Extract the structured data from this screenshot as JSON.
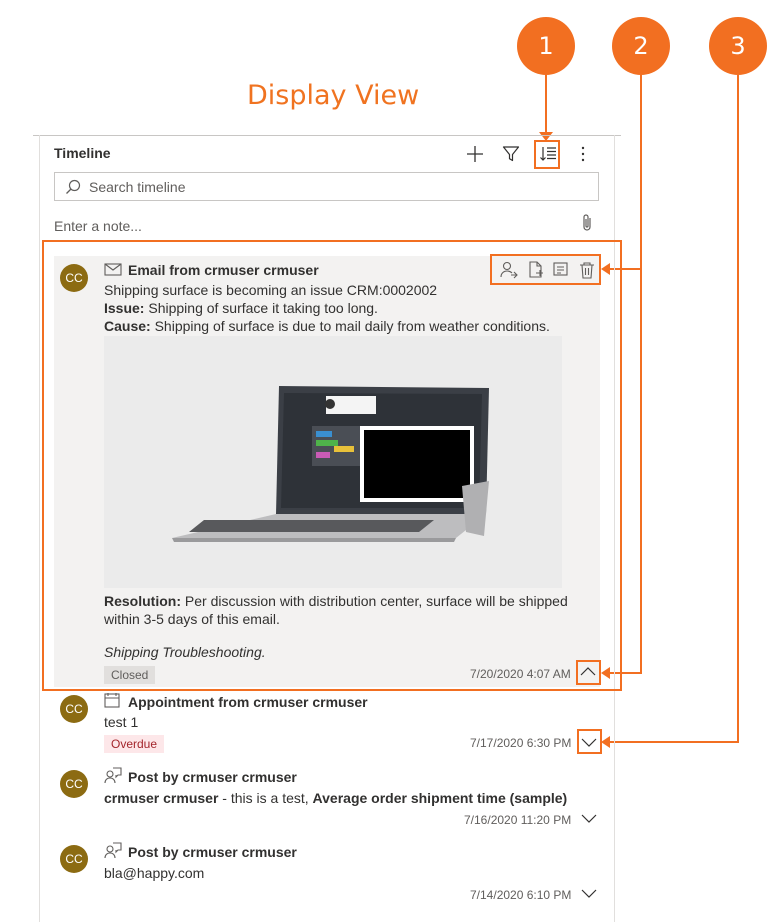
{
  "page_title": "Display View",
  "callouts": [
    "1",
    "2",
    "3"
  ],
  "timeline": {
    "title": "Timeline",
    "search_placeholder": "Search timeline",
    "note_placeholder": "Enter a note..."
  },
  "records": [
    {
      "type": "email",
      "header": "Email from crmuser crmuser",
      "subject": "Shipping surface is becoming an issue CRM:0002002",
      "issue_label": "Issue:",
      "issue_text": "Shipping of surface it taking too long.",
      "cause_label": "Cause:",
      "cause_text": "Shipping of surface is due to mail daily from weather conditions.",
      "resolution_label": "Resolution:",
      "resolution_text_1": "Per discussion with distribution center, surface will be shipped",
      "resolution_text_2": "within 3-5 days of this email.",
      "signature": "Shipping Troubleshooting.",
      "status": "Closed",
      "timestamp": "7/20/2020 4:07 AM",
      "avatar": "CC"
    },
    {
      "type": "appointment",
      "header": "Appointment from crmuser crmuser",
      "body": "test 1",
      "status": "Overdue",
      "timestamp": "7/17/2020 6:30 PM",
      "avatar": "CC"
    },
    {
      "type": "post",
      "header": "Post by crmuser crmuser",
      "body_bold_1": "crmuser crmuser",
      "body_plain": " - this is a test, ",
      "body_bold_2": "Average order shipment time (sample)",
      "timestamp": "7/16/2020 11:20 PM",
      "avatar": "CC"
    },
    {
      "type": "post",
      "header": "Post by crmuser crmuser",
      "body": "bla@happy.com",
      "timestamp": "7/14/2020 6:10 PM",
      "avatar": "CC"
    }
  ],
  "colors": {
    "accent": "#f26f21",
    "avatar": "#8c6b12",
    "overdue": "#a4262c",
    "card": "#f3f2f1"
  }
}
